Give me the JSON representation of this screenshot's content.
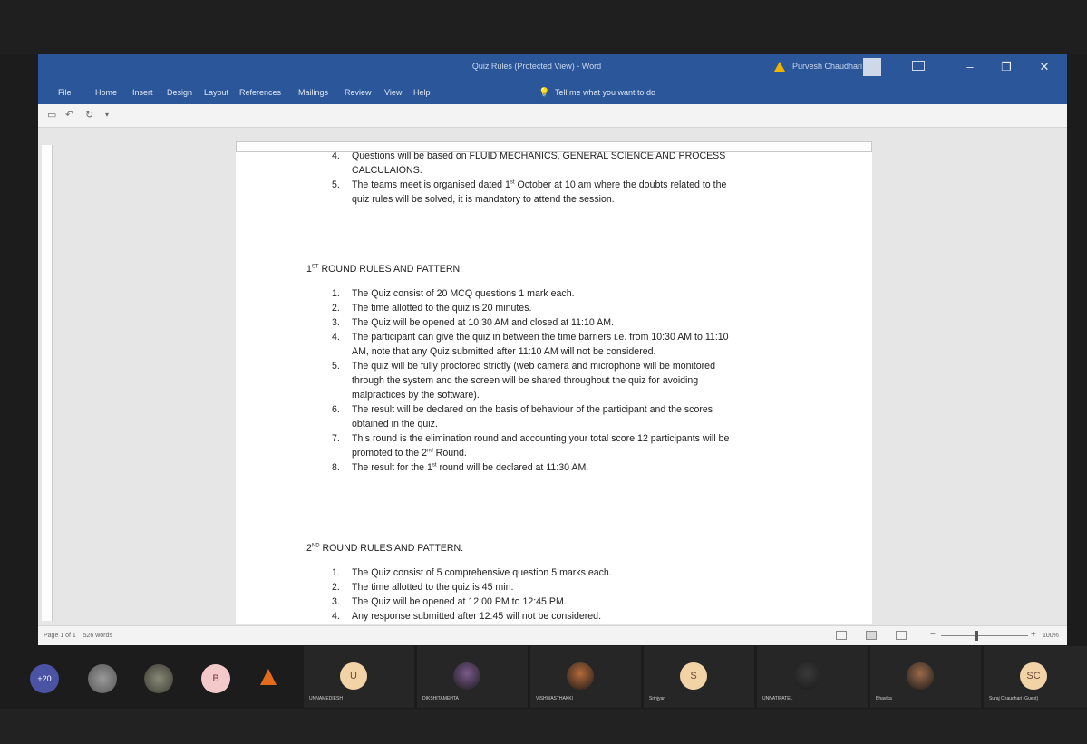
{
  "window": {
    "title": "Quiz Rules (Protected View) - Word",
    "user": "Purvesh Chaudhari"
  },
  "ribbon": {
    "tabs": [
      "File",
      "Home",
      "Insert",
      "Design",
      "Layout",
      "References",
      "Mailings",
      "Review",
      "View",
      "Help"
    ],
    "tell_me": "Tell me what you want to do"
  },
  "doc": {
    "pre_items": [
      {
        "num": "4.",
        "lines": [
          "Questions will be based on FLUID MECHANICS, GENERAL SCIENCE AND PROCESS",
          "CALCULAIONS."
        ]
      },
      {
        "num": "5.",
        "lines": [
          "The teams meet is organised dated 1st October at 10 am where the doubts related to the",
          "quiz rules will be solved, it is mandatory to attend the session."
        ]
      }
    ],
    "round1": {
      "heading": "1ST ROUND RULES AND PATTERN:",
      "items": [
        {
          "num": "1.",
          "lines": [
            "The Quiz consist of 20 MCQ questions 1 mark each."
          ]
        },
        {
          "num": "2.",
          "lines": [
            "The time allotted to the quiz is 20 minutes."
          ]
        },
        {
          "num": "3.",
          "lines": [
            "The Quiz will be opened at 10:30 AM and closed at 11:10 AM."
          ]
        },
        {
          "num": "4.",
          "lines": [
            "The participant can give the quiz in between the time barriers i.e. from 10:30 AM to 11:10",
            "AM, note that any Quiz submitted after 11:10 AM will not be considered."
          ]
        },
        {
          "num": "5.",
          "lines": [
            "The quiz will be fully proctored strictly (web camera and microphone will be monitored",
            "through the system and the screen will be shared throughout the quiz for avoiding",
            "malpractices by the software)."
          ]
        },
        {
          "num": "6.",
          "lines": [
            "The result will be declared on the basis of behaviour of the participant and the scores",
            "obtained in the quiz."
          ]
        },
        {
          "num": "7.",
          "lines": [
            "This round is the elimination round and accounting your total score 12 participants will be",
            "promoted to the 2nd Round."
          ]
        },
        {
          "num": "8.",
          "lines": [
            "The result for the 1st round will be declared at 11:30 AM."
          ]
        }
      ]
    },
    "round2": {
      "heading": "2ND ROUND RULES AND PATTERN:",
      "items": [
        {
          "num": "1.",
          "lines": [
            "The Quiz consist of 5 comprehensive question 5 marks each."
          ]
        },
        {
          "num": "2.",
          "lines": [
            "The time allotted to the quiz is 45 min."
          ]
        },
        {
          "num": "3.",
          "lines": [
            "The Quiz will be opened at 12:00 PM to 12:45 PM."
          ]
        },
        {
          "num": "4.",
          "lines": [
            "Any response submitted after 12:45 will not be considered."
          ]
        }
      ]
    }
  },
  "status": {
    "page": "Page 1 of 1",
    "words": "526 words",
    "zoom": "100%",
    "zoom_fraction": 0.4
  },
  "meeting": {
    "more_count": "+20",
    "small_avatar_letter": "B",
    "tiles": [
      {
        "initial": "U",
        "name": "UNNAMEDIESH",
        "bg": "#f2d3a6",
        "photo": false
      },
      {
        "initial": "",
        "name": "DIKSHITAMEHTA",
        "bg": "#7a5a8c",
        "photo": true
      },
      {
        "initial": "",
        "name": "VISHWASTHAKKI",
        "bg": "#b56a3a",
        "photo": true
      },
      {
        "initial": "S",
        "name": "Srinjyan",
        "bg": "#f2d3a6",
        "photo": false
      },
      {
        "initial": "",
        "name": "UNNATIPATEL",
        "bg": "#3a3a3a",
        "photo": true
      },
      {
        "initial": "",
        "name": "Bhavika",
        "bg": "#9a6a4a",
        "photo": true
      },
      {
        "initial": "SC",
        "name": "Suraj Chaudhari (Guest)",
        "bg": "#f2d3a6",
        "photo": false
      }
    ]
  }
}
